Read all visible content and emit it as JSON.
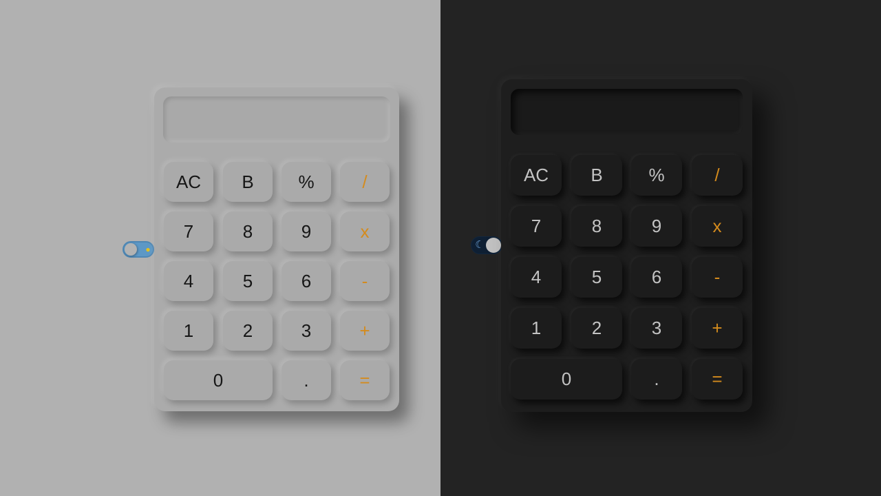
{
  "light_calculator": {
    "display": "",
    "theme_toggle_icon": "sun-icon",
    "keys": [
      "AC",
      "B",
      "%",
      "/",
      "7",
      "8",
      "9",
      "x",
      "4",
      "5",
      "6",
      "-",
      "1",
      "2",
      "3",
      "+",
      "0",
      ".",
      "="
    ]
  },
  "dark_calculator": {
    "display": "",
    "theme_toggle_icon": "moon-icon",
    "keys": [
      "AC",
      "B",
      "%",
      "/",
      "7",
      "8",
      "9",
      "x",
      "4",
      "5",
      "6",
      "-",
      "1",
      "2",
      "3",
      "+",
      "0",
      ".",
      "="
    ]
  },
  "colors": {
    "light_background": "#b1b1b1",
    "dark_background": "#232323",
    "operator_accent": "#d48b1d",
    "toggle_light_track": "#5d98c6",
    "toggle_dark_track": "#0e1f33"
  }
}
